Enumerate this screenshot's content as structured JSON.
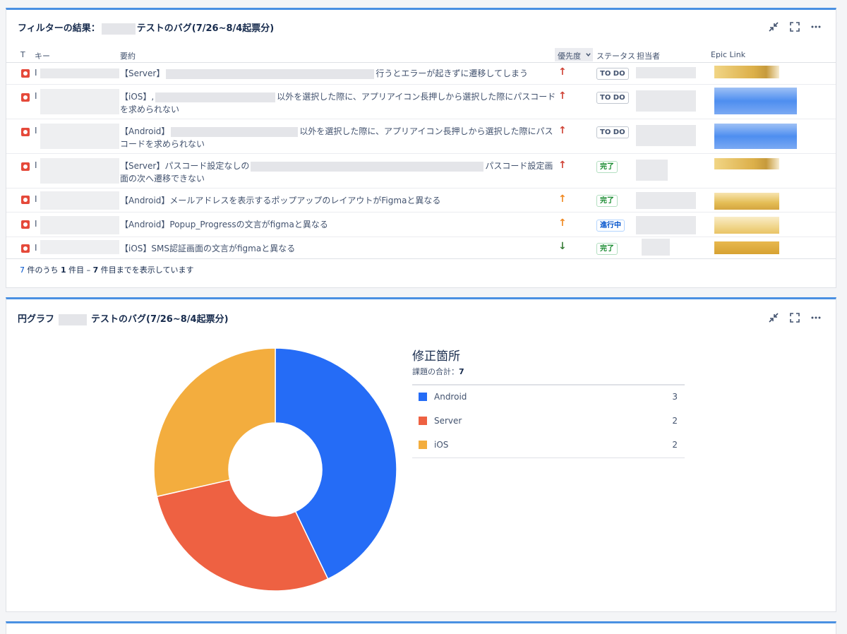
{
  "filter_gadget": {
    "title_prefix": "フィルターの結果：",
    "title_suffix": "テストのバグ(7/26~8/4起票分)",
    "columns": {
      "type": "T",
      "key": "キー",
      "summary": "要約",
      "priority": "優先度",
      "status": "ステータス",
      "assignee": "担当者",
      "epic_link": "Epic Link"
    },
    "rows": [
      {
        "key": "I",
        "summary": "【Server】",
        "summary_tail": "行うとエラーが起きずに遷移してしまう",
        "status": "TO DO",
        "priority": "↑"
      },
      {
        "key": "I",
        "summary": "【iOS】,",
        "summary_tail": "以外を選択した際に、アプリアイコン長押しから選択した際にパスコードを求められない",
        "status": "TO DO",
        "priority": "↑"
      },
      {
        "key": "I",
        "summary": "【Android】",
        "summary_tail": "以外を選択した際に、アプリアイコン長押しから選択した際にパスコードを求められない",
        "status": "TO DO",
        "priority": "↑"
      },
      {
        "key": "I",
        "summary": "【Server】パスコード設定なしの",
        "summary_tail": "パスコード設定画面の次へ遷移できない",
        "status": "完了",
        "priority": "↑"
      },
      {
        "key": "I",
        "summary": "【Android】メールアドレスを表示するポップアップのレイアウトがFigmaと異なる",
        "summary_tail": "",
        "status": "完了",
        "priority": "↑"
      },
      {
        "key": "I",
        "summary": "【Android】Popup_Progressの文言がfigmaと異なる",
        "summary_tail": "",
        "status": "進行中",
        "priority": "↑"
      },
      {
        "key": "I",
        "summary": "【iOS】SMS認証画面の文言がfigmaと異なる",
        "summary_tail": "",
        "status": "完了",
        "priority": "↓"
      }
    ],
    "pager": {
      "total": "7",
      "text1": " 件のうち ",
      "from": "1",
      "text2": " 件目 – ",
      "to": "7",
      "text3": " 件目までを表示しています"
    }
  },
  "pie_gadget": {
    "title_prefix": "円グラフ",
    "title_suffix": "テストのバグ(7/26~8/4起票分)",
    "legend_title": "修正箇所",
    "total_label": "課題の合計：",
    "total_value": "7"
  },
  "chart_data": {
    "type": "pie",
    "donut": true,
    "title": "修正箇所",
    "slices": [
      {
        "label": "Android",
        "value": 3,
        "color": "#256cf6"
      },
      {
        "label": "Server",
        "value": 2,
        "color": "#ee6142"
      },
      {
        "label": "iOS",
        "value": 2,
        "color": "#f3ad3e"
      }
    ]
  },
  "colors": {
    "accent": "#4a90e2",
    "bug_red": "#e5493a",
    "priority_high": "#d04437",
    "priority_medium": "#f08a24",
    "priority_low": "#3b7f3b",
    "status_todo": "#42526e",
    "status_done": "#14892c",
    "status_inprogress": "#0052cc"
  },
  "icons": {
    "minimize": "minimize-icon",
    "maximize": "maximize-icon",
    "more": "more-icon",
    "bug": "bug-icon"
  }
}
